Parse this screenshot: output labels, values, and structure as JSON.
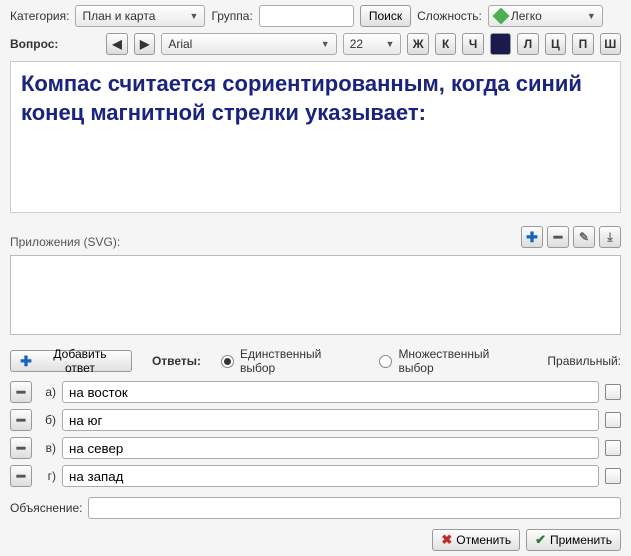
{
  "toolbar": {
    "category_label": "Категория:",
    "category_value": "План и карта",
    "group_label": "Группа:",
    "group_value": "",
    "search_label": "Поиск",
    "difficulty_label": "Сложность:",
    "difficulty_value": "Легко"
  },
  "question_bar": {
    "label": "Вопрос:",
    "font_value": "Arial",
    "size_value": "22",
    "fmt_buttons": [
      "Ж",
      "К",
      "Ч",
      "",
      "Л",
      "Ц",
      "П",
      "Ш"
    ]
  },
  "question": {
    "text": "Компас считается сориентированным, когда синий конец магнитной стрелки указывает:"
  },
  "attachments": {
    "label": "Приложения (SVG):"
  },
  "answers": {
    "add_label": "Добавить ответ",
    "header_label": "Ответы:",
    "single_label": "Единственный выбор",
    "multiple_label": "Множественный выбор",
    "correct_label": "Правильный:",
    "choice_mode": "single",
    "rows": [
      {
        "letter": "а)",
        "text": "на восток",
        "correct": false
      },
      {
        "letter": "б)",
        "text": "на юг",
        "correct": false
      },
      {
        "letter": "в)",
        "text": "на север",
        "correct": false
      },
      {
        "letter": "г)",
        "text": "на запад",
        "correct": false
      }
    ]
  },
  "explain": {
    "label": "Объяснение:",
    "value": ""
  },
  "buttons": {
    "cancel": "Отменить",
    "apply": "Применить"
  }
}
